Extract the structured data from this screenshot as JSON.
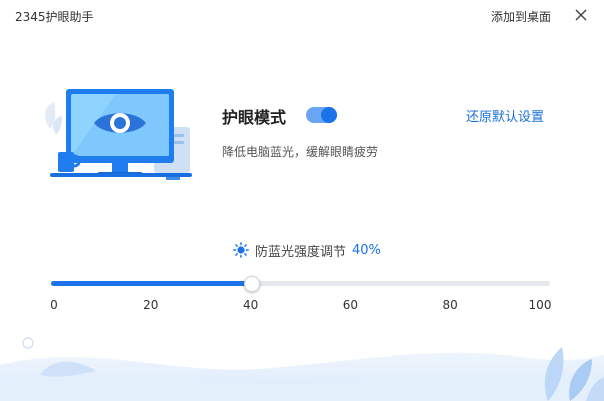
{
  "window": {
    "title": "2345护眼助手",
    "add_to_desktop": "添加到桌面"
  },
  "eye_mode": {
    "title": "护眼模式",
    "enabled": true,
    "restore_default": "还原默认设置",
    "description": "降低电脑蓝光，缓解眼睛疲劳"
  },
  "blue_light": {
    "label": "防蓝光强度调节",
    "value_text": "40%",
    "value": 40,
    "min": 0,
    "max": 100,
    "ticks": [
      "0",
      "20",
      "40",
      "60",
      "80",
      "100"
    ]
  },
  "colors": {
    "accent": "#1a73e8",
    "toggle_track": "#6aa5f5",
    "slider_track": "#e6e9ee"
  }
}
